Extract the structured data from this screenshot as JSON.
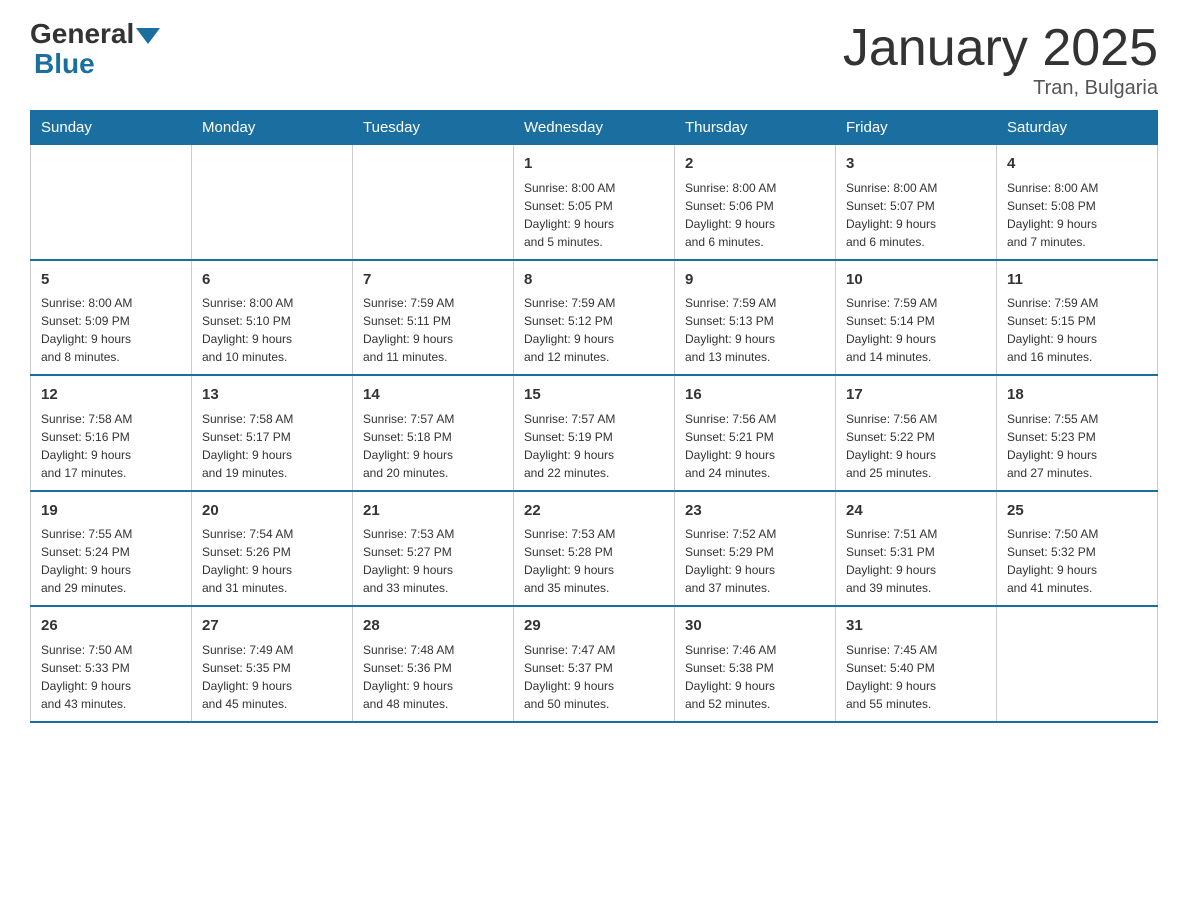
{
  "header": {
    "logo": {
      "general": "General",
      "blue": "Blue"
    },
    "title": "January 2025",
    "location": "Tran, Bulgaria"
  },
  "calendar": {
    "days_of_week": [
      "Sunday",
      "Monday",
      "Tuesday",
      "Wednesday",
      "Thursday",
      "Friday",
      "Saturday"
    ],
    "weeks": [
      [
        {
          "day": "",
          "info": ""
        },
        {
          "day": "",
          "info": ""
        },
        {
          "day": "",
          "info": ""
        },
        {
          "day": "1",
          "info": "Sunrise: 8:00 AM\nSunset: 5:05 PM\nDaylight: 9 hours\nand 5 minutes."
        },
        {
          "day": "2",
          "info": "Sunrise: 8:00 AM\nSunset: 5:06 PM\nDaylight: 9 hours\nand 6 minutes."
        },
        {
          "day": "3",
          "info": "Sunrise: 8:00 AM\nSunset: 5:07 PM\nDaylight: 9 hours\nand 6 minutes."
        },
        {
          "day": "4",
          "info": "Sunrise: 8:00 AM\nSunset: 5:08 PM\nDaylight: 9 hours\nand 7 minutes."
        }
      ],
      [
        {
          "day": "5",
          "info": "Sunrise: 8:00 AM\nSunset: 5:09 PM\nDaylight: 9 hours\nand 8 minutes."
        },
        {
          "day": "6",
          "info": "Sunrise: 8:00 AM\nSunset: 5:10 PM\nDaylight: 9 hours\nand 10 minutes."
        },
        {
          "day": "7",
          "info": "Sunrise: 7:59 AM\nSunset: 5:11 PM\nDaylight: 9 hours\nand 11 minutes."
        },
        {
          "day": "8",
          "info": "Sunrise: 7:59 AM\nSunset: 5:12 PM\nDaylight: 9 hours\nand 12 minutes."
        },
        {
          "day": "9",
          "info": "Sunrise: 7:59 AM\nSunset: 5:13 PM\nDaylight: 9 hours\nand 13 minutes."
        },
        {
          "day": "10",
          "info": "Sunrise: 7:59 AM\nSunset: 5:14 PM\nDaylight: 9 hours\nand 14 minutes."
        },
        {
          "day": "11",
          "info": "Sunrise: 7:59 AM\nSunset: 5:15 PM\nDaylight: 9 hours\nand 16 minutes."
        }
      ],
      [
        {
          "day": "12",
          "info": "Sunrise: 7:58 AM\nSunset: 5:16 PM\nDaylight: 9 hours\nand 17 minutes."
        },
        {
          "day": "13",
          "info": "Sunrise: 7:58 AM\nSunset: 5:17 PM\nDaylight: 9 hours\nand 19 minutes."
        },
        {
          "day": "14",
          "info": "Sunrise: 7:57 AM\nSunset: 5:18 PM\nDaylight: 9 hours\nand 20 minutes."
        },
        {
          "day": "15",
          "info": "Sunrise: 7:57 AM\nSunset: 5:19 PM\nDaylight: 9 hours\nand 22 minutes."
        },
        {
          "day": "16",
          "info": "Sunrise: 7:56 AM\nSunset: 5:21 PM\nDaylight: 9 hours\nand 24 minutes."
        },
        {
          "day": "17",
          "info": "Sunrise: 7:56 AM\nSunset: 5:22 PM\nDaylight: 9 hours\nand 25 minutes."
        },
        {
          "day": "18",
          "info": "Sunrise: 7:55 AM\nSunset: 5:23 PM\nDaylight: 9 hours\nand 27 minutes."
        }
      ],
      [
        {
          "day": "19",
          "info": "Sunrise: 7:55 AM\nSunset: 5:24 PM\nDaylight: 9 hours\nand 29 minutes."
        },
        {
          "day": "20",
          "info": "Sunrise: 7:54 AM\nSunset: 5:26 PM\nDaylight: 9 hours\nand 31 minutes."
        },
        {
          "day": "21",
          "info": "Sunrise: 7:53 AM\nSunset: 5:27 PM\nDaylight: 9 hours\nand 33 minutes."
        },
        {
          "day": "22",
          "info": "Sunrise: 7:53 AM\nSunset: 5:28 PM\nDaylight: 9 hours\nand 35 minutes."
        },
        {
          "day": "23",
          "info": "Sunrise: 7:52 AM\nSunset: 5:29 PM\nDaylight: 9 hours\nand 37 minutes."
        },
        {
          "day": "24",
          "info": "Sunrise: 7:51 AM\nSunset: 5:31 PM\nDaylight: 9 hours\nand 39 minutes."
        },
        {
          "day": "25",
          "info": "Sunrise: 7:50 AM\nSunset: 5:32 PM\nDaylight: 9 hours\nand 41 minutes."
        }
      ],
      [
        {
          "day": "26",
          "info": "Sunrise: 7:50 AM\nSunset: 5:33 PM\nDaylight: 9 hours\nand 43 minutes."
        },
        {
          "day": "27",
          "info": "Sunrise: 7:49 AM\nSunset: 5:35 PM\nDaylight: 9 hours\nand 45 minutes."
        },
        {
          "day": "28",
          "info": "Sunrise: 7:48 AM\nSunset: 5:36 PM\nDaylight: 9 hours\nand 48 minutes."
        },
        {
          "day": "29",
          "info": "Sunrise: 7:47 AM\nSunset: 5:37 PM\nDaylight: 9 hours\nand 50 minutes."
        },
        {
          "day": "30",
          "info": "Sunrise: 7:46 AM\nSunset: 5:38 PM\nDaylight: 9 hours\nand 52 minutes."
        },
        {
          "day": "31",
          "info": "Sunrise: 7:45 AM\nSunset: 5:40 PM\nDaylight: 9 hours\nand 55 minutes."
        },
        {
          "day": "",
          "info": ""
        }
      ]
    ]
  }
}
